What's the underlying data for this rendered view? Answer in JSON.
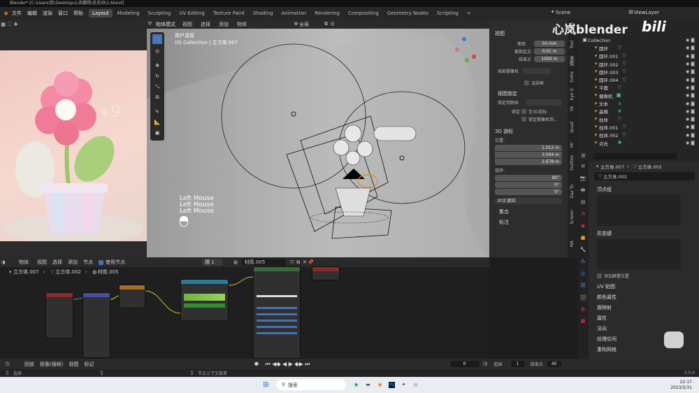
{
  "window": {
    "title": "Blender* [C:\\Users\\阮\\Desktop\\心岚教程\\花花动\\1.blend]"
  },
  "menu": [
    "文件",
    "编辑",
    "渲染",
    "窗口",
    "帮助"
  ],
  "workspaces": [
    "Layout",
    "Modeling",
    "Sculpting",
    "UV Editing",
    "Texture Paint",
    "Shading",
    "Animation",
    "Rendering",
    "Compositing",
    "Geometry Nodes",
    "Scripting"
  ],
  "active_workspace": "Layout",
  "scene": "Scene",
  "view_layer": "ViewLayer",
  "watermark": "心岚blender",
  "viewport": {
    "mode": "物体模式",
    "menu": [
      "视图",
      "选择",
      "添加",
      "物体"
    ],
    "transform_orient": "全局",
    "overlay_title": "用户透视",
    "overlay_collection": "(0) Collection | 立方体.007",
    "mouse_hint": [
      "Left Mouse",
      "Left Mouse",
      "Left Mouse"
    ]
  },
  "npanel": {
    "view_header": "视图",
    "focal_label": "焦距",
    "focal": "50 mm",
    "clip_start_label": "裁剪起点",
    "clip_start": "0.01 m",
    "clip_end_label": "结束点",
    "clip_end": "1000 m",
    "local_camera": "局部摄像机",
    "render_region": "渲染框",
    "view_lock": "视图锁定",
    "lock_to_object": "锁定到物体",
    "lock_label": "锁定",
    "to_3d_cursor": "至3D游标",
    "lock_camera": "锁定摄像机到...",
    "cursor_header": "3D 游标",
    "location_label": "位置:",
    "x": "1.012 m",
    "y": "3.094 m",
    "z": "2.678 m",
    "rotation_label": "旋转:",
    "rx": "90°",
    "ry": "0°",
    "rz": "0°",
    "rot_mode": "XYZ 欧拉",
    "collections": "集合",
    "annotations": "标注"
  },
  "side_tabs": [
    "Item",
    "Tool",
    "View",
    "Extre",
    "Eye D",
    "FA",
    "Quad",
    "MI",
    "Outline",
    "Daz To",
    "Screen",
    "MA"
  ],
  "outliner": {
    "root": "Collection",
    "items": [
      "圆环",
      "圆环.001",
      "圆环.002",
      "圆环.003",
      "圆环.004",
      "平面",
      "摄像机",
      "文本",
      "晶格",
      "柱体",
      "柱体.001",
      "柱体.002",
      "点光"
    ]
  },
  "properties": {
    "breadcrumb_obj": "立方体.007",
    "breadcrumb_mesh": "立方体.002",
    "mesh_name": "立方体.002",
    "sections": [
      "顶点组",
      "形态键",
      "UV 贴图",
      "颜色属性",
      "面映射",
      "属性",
      "法向",
      "纹理空间",
      "重构网格"
    ],
    "add_rest_position": "添加静置位置"
  },
  "node_editor": {
    "type": "物体",
    "menu": [
      "视图",
      "选择",
      "添加",
      "节点"
    ],
    "use_nodes": "使用节点",
    "slot": "槽 1",
    "material": "材质.005",
    "breadcrumb": [
      "立方体.007",
      "立方体.002",
      "材质.005"
    ]
  },
  "timeline": {
    "menu": [
      "回放",
      "抠像(插帧)",
      "视图",
      "标记"
    ],
    "current": "0",
    "start_label": "起始",
    "start": "1",
    "end_label": "结束点",
    "end": "40"
  },
  "status": {
    "left": "选择",
    "mid": "节点上下文菜单",
    "version": "3.5.0"
  },
  "taskbar": {
    "search": "搜索",
    "time": "22:17",
    "date": "2023/5/31"
  }
}
